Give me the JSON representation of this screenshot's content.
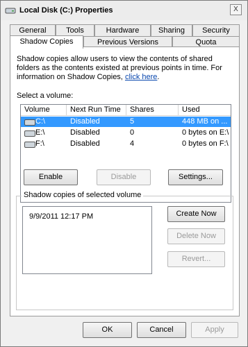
{
  "window": {
    "title": "Local Disk (C:) Properties",
    "close_symbol": "X"
  },
  "tabs": {
    "row1": [
      "General",
      "Tools",
      "Hardware",
      "Sharing",
      "Security"
    ],
    "row2": [
      "Shadow Copies",
      "Previous Versions",
      "Quota"
    ],
    "active": "Shadow Copies"
  },
  "description": {
    "text": "Shadow copies allow users to view the contents of shared folders as the contents existed at previous points in time. For information on Shadow Copies, ",
    "link": "click here",
    "end": "."
  },
  "volumes": {
    "label": "Select a volume:",
    "columns": [
      "Volume",
      "Next Run Time",
      "Shares",
      "Used"
    ],
    "rows": [
      {
        "volume": "C:\\",
        "next_run": "Disabled",
        "shares": "5",
        "used": "448 MB on ..."
      },
      {
        "volume": "E:\\",
        "next_run": "Disabled",
        "shares": "0",
        "used": "0 bytes on E:\\"
      },
      {
        "volume": "F:\\",
        "next_run": "Disabled",
        "shares": "4",
        "used": "0 bytes on F:\\"
      }
    ],
    "selected_index": 0
  },
  "actions": {
    "enable": "Enable",
    "disable": "Disable",
    "settings": "Settings..."
  },
  "copies": {
    "label": "Shadow copies of selected volume",
    "items": [
      "9/9/2011 12:17 PM"
    ],
    "create": "Create Now",
    "delete": "Delete Now",
    "revert": "Revert..."
  },
  "footer": {
    "ok": "OK",
    "cancel": "Cancel",
    "apply": "Apply"
  }
}
